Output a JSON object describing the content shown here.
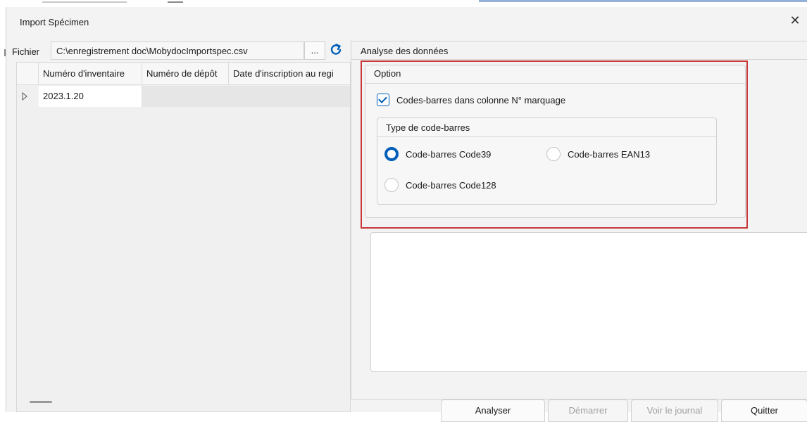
{
  "window": {
    "title": "Import Spécimen",
    "close_glyph": "✕"
  },
  "file": {
    "label": "Fichier",
    "path": "C:\\enregistrement doc\\MobydocImportspec.csv",
    "browse_label": "...",
    "refresh_icon": "refresh-icon"
  },
  "grid": {
    "columns": [
      "Numéro d'inventaire",
      "Numéro de dépôt",
      "Date d'inscription au regi"
    ],
    "rows": [
      {
        "inventory_number": "2023.1.20"
      }
    ]
  },
  "analysis": {
    "header": "Analyse des données"
  },
  "option": {
    "title": "Option",
    "barcode_checkbox_label": "Codes-barres dans colonne N° marquage",
    "barcode_checkbox_checked": true,
    "barcode_type": {
      "title": "Type de code-barres",
      "options": [
        "Code-barres Code39",
        "Code-barres EAN13",
        "Code-barres Code128"
      ],
      "selected": "Code-barres Code39"
    }
  },
  "buttons": {
    "analyser": "Analyser",
    "demarrer": "Démarrer",
    "voir_journal": "Voir le journal",
    "quitter": "Quitter"
  },
  "colors": {
    "accent": "#005fb8",
    "highlight": "#c8373a"
  }
}
